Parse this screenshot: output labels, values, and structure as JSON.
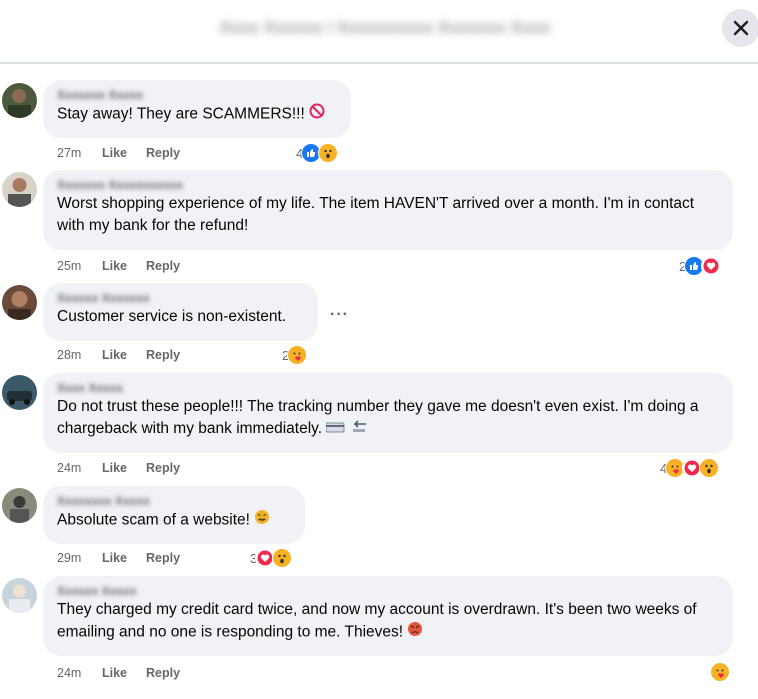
{
  "header": {
    "title": "Xxxx Xxxxxx / Xxxxxxxxxx Xxxxxxx Xxxx"
  },
  "comments": [
    {
      "author": "Xxxxxxx Xxxxx",
      "text": "Stay away! They are SCAMMERS!!!",
      "time": "27m",
      "like": "Like",
      "reply": "Reply",
      "reaction_count": "4",
      "reactions": [
        "like",
        "wow"
      ]
    },
    {
      "author": "Xxxxxxx Xxxxxxxxxxx",
      "text": "Worst shopping experience of my life. The item HAVEN'T arrived over a month. I'm in contact with my bank for the refund!",
      "time": "25m",
      "like": "Like",
      "reply": "Reply",
      "reaction_count": "2",
      "reactions": [
        "like",
        "love"
      ]
    },
    {
      "author": "Xxxxxx Xxxxxxx",
      "text": "Customer service is non-existent.",
      "time": "28m",
      "like": "Like",
      "reply": "Reply",
      "reaction_count": "2",
      "reactions": [
        "care"
      ]
    },
    {
      "author": "Xxxx Xxxxx",
      "text": "Do not trust these people!!! The tracking number they gave me doesn't even exist. I'm doing a chargeback with my bank immediately.",
      "time": "24m",
      "like": "Like",
      "reply": "Reply",
      "reaction_count": "4",
      "reactions": [
        "care",
        "love",
        "wow"
      ]
    },
    {
      "author": "Xxxxxxxx Xxxxx",
      "text": "Absolute scam of a website!",
      "time": "29m",
      "like": "Like",
      "reply": "Reply",
      "reaction_count": "3",
      "reactions": [
        "love",
        "wow"
      ]
    },
    {
      "author": "Xxxxxx Xxxxx",
      "text": "They charged my credit card twice, and now my account is overdrawn. It's been two weeks of emailing and no one is responding to me. Thieves!",
      "time": "24m",
      "like": "Like",
      "reply": "Reply",
      "reaction_count": "",
      "reactions": [
        "care"
      ]
    }
  ],
  "colors": {
    "bubble": "#f0f2f5",
    "meta": "#65676b",
    "like_blue": "#1877f2",
    "love_red": "#f02849",
    "emoji_yellow": "#f7b125"
  },
  "icons": {
    "close": "close-icon",
    "more": "more-options-icon"
  }
}
